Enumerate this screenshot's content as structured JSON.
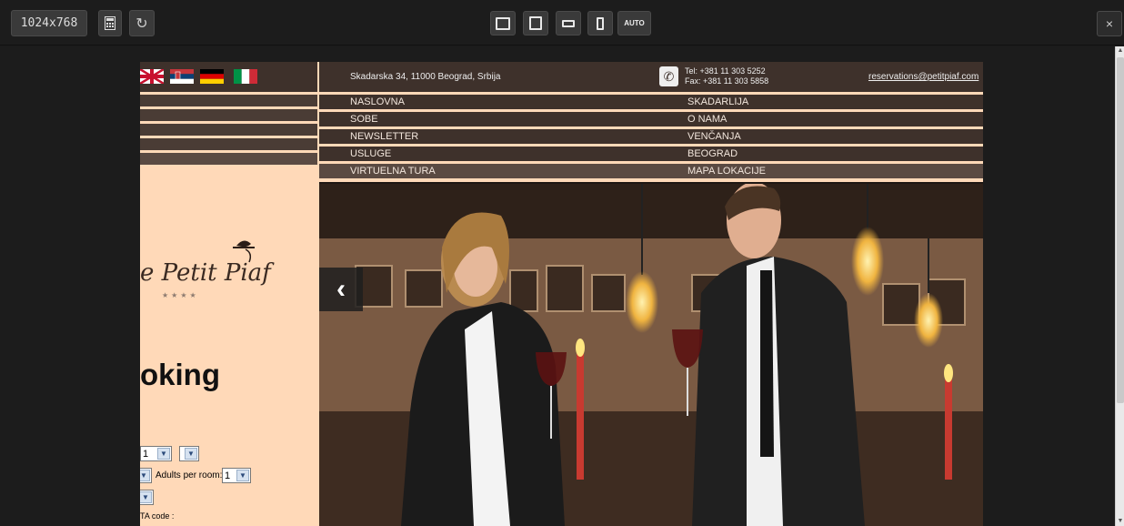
{
  "toolbar": {
    "size_label": "1024x768",
    "auto_label": "AUTO",
    "close_label": "×"
  },
  "site": {
    "flags": [
      "uk-flag",
      "serbia-flag",
      "germany-flag",
      "italy-flag"
    ],
    "logo_text": "e Petit Piaf",
    "logo_stars": "★★★★",
    "booking_title": "oking",
    "booking_select_1": "1",
    "adults_label": "Adults per room:",
    "adults_value": "1",
    "iata_label": "TA code :",
    "address": "Skadarska 34, 11000 Beograd, Srbija",
    "tel": "Tel: +381 11 303 5252",
    "fax": "Fax: +381 11 303 5858",
    "email": "reservations@petitpiaf.com",
    "nav": [
      {
        "left": "NASLOVNA",
        "right": "SKADARLIJA"
      },
      {
        "left": "SOBE",
        "right": "O NAMA"
      },
      {
        "left": "NEWSLETTER",
        "right": "VENČANJA"
      },
      {
        "left": "USLUGE",
        "right": "BEOGRAD"
      },
      {
        "left": "VIRTUELNA TURA",
        "right": "MAPA LOKACIJE"
      }
    ],
    "prev_arrow": "‹"
  },
  "colors": {
    "page_bg": "#1b1b1b",
    "site_bg": "#ffd9b8",
    "nav_bg": "#3e312b"
  }
}
